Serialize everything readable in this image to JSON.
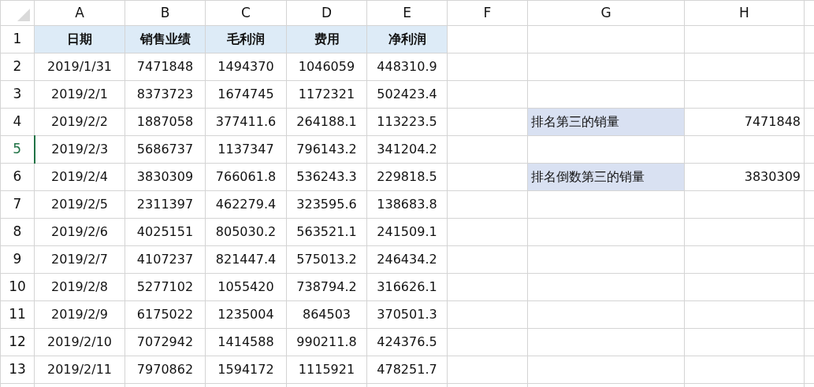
{
  "columns": [
    "A",
    "B",
    "C",
    "D",
    "E",
    "F",
    "G",
    "H"
  ],
  "rows": [
    {
      "number": "1",
      "selected": false,
      "kind": "header",
      "values": [
        "日期",
        "销售业绩",
        "毛利润",
        "费用",
        "净利润"
      ]
    },
    {
      "number": "2",
      "selected": false,
      "kind": "data",
      "values": [
        "2019/1/31",
        "7471848",
        "1494370",
        "1046059",
        "448310.9"
      ]
    },
    {
      "number": "3",
      "selected": false,
      "kind": "data",
      "values": [
        "2019/2/1",
        "8373723",
        "1674745",
        "1172321",
        "502423.4"
      ]
    },
    {
      "number": "4",
      "selected": false,
      "kind": "data",
      "values": [
        "2019/2/2",
        "1887058",
        "377411.6",
        "264188.1",
        "113223.5"
      ],
      "side": {
        "label": "排名第三的销量",
        "value": "7471848"
      }
    },
    {
      "number": "5",
      "selected": true,
      "kind": "data",
      "values": [
        "2019/2/3",
        "5686737",
        "1137347",
        "796143.2",
        "341204.2"
      ]
    },
    {
      "number": "6",
      "selected": false,
      "kind": "data",
      "values": [
        "2019/2/4",
        "3830309",
        "766061.8",
        "536243.3",
        "229818.5"
      ],
      "side": {
        "label": "排名倒数第三的销量",
        "value": "3830309"
      }
    },
    {
      "number": "7",
      "selected": false,
      "kind": "data",
      "values": [
        "2019/2/5",
        "2311397",
        "462279.4",
        "323595.6",
        "138683.8"
      ]
    },
    {
      "number": "8",
      "selected": false,
      "kind": "data",
      "values": [
        "2019/2/6",
        "4025151",
        "805030.2",
        "563521.1",
        "241509.1"
      ]
    },
    {
      "number": "9",
      "selected": false,
      "kind": "data",
      "values": [
        "2019/2/7",
        "4107237",
        "821447.4",
        "575013.2",
        "246434.2"
      ]
    },
    {
      "number": "10",
      "selected": false,
      "kind": "data",
      "values": [
        "2019/2/8",
        "5277102",
        "1055420",
        "738794.2",
        "316626.1"
      ]
    },
    {
      "number": "11",
      "selected": false,
      "kind": "data",
      "values": [
        "2019/2/9",
        "6175022",
        "1235004",
        "864503",
        "370501.3"
      ]
    },
    {
      "number": "12",
      "selected": false,
      "kind": "data",
      "values": [
        "2019/2/10",
        "7072942",
        "1414588",
        "990211.8",
        "424376.5"
      ]
    },
    {
      "number": "13",
      "selected": false,
      "kind": "data",
      "values": [
        "2019/2/11",
        "7970862",
        "1594172",
        "1115921",
        "478251.7"
      ]
    }
  ]
}
